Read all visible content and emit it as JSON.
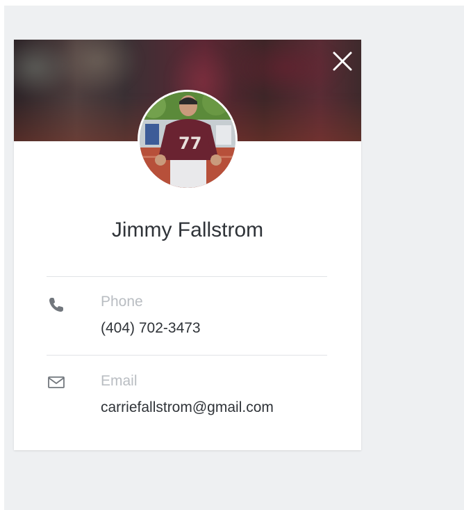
{
  "contact": {
    "name": "Jimmy Fallstrom",
    "phone_label": "Phone",
    "phone_value": "(404) 702-3473",
    "email_label": "Email",
    "email_value": "carriefallstrom@gmail.com"
  },
  "icons": {
    "close": "close-icon",
    "phone": "phone-icon",
    "email": "envelope-icon"
  },
  "colors": {
    "background": "#eef0f2",
    "card": "#ffffff",
    "primary_text": "#2f3338",
    "label_text": "#b9bdc2",
    "jersey": "#6a2331"
  }
}
